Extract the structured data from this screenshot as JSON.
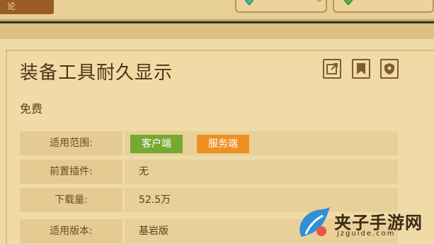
{
  "tabs": {
    "active_label": "论"
  },
  "plugin": {
    "title": "装备工具耐久显示",
    "price": "免费"
  },
  "details": [
    {
      "label": "适用范围:",
      "tags": [
        {
          "text": "客户端",
          "color": "#77a832"
        },
        {
          "text": "服务端",
          "color": "#ef8f22"
        }
      ]
    },
    {
      "label": "前置插件:",
      "value": "无"
    },
    {
      "label": "下载量:",
      "value": "52.5万"
    },
    {
      "label": "适用版本:",
      "value": "基岩版"
    }
  ],
  "actions": {
    "share_icon": "external-link-icon",
    "bookmark_icon": "bookmark-icon",
    "shield_icon": "shield-icon"
  },
  "watermark": {
    "text": "夹子手游网",
    "url": "jzguide.com"
  },
  "colors": {
    "panel": "#f0dba6",
    "text_dark": "#4f3517",
    "client_tag": "#77a832",
    "server_tag": "#ef8f22"
  }
}
